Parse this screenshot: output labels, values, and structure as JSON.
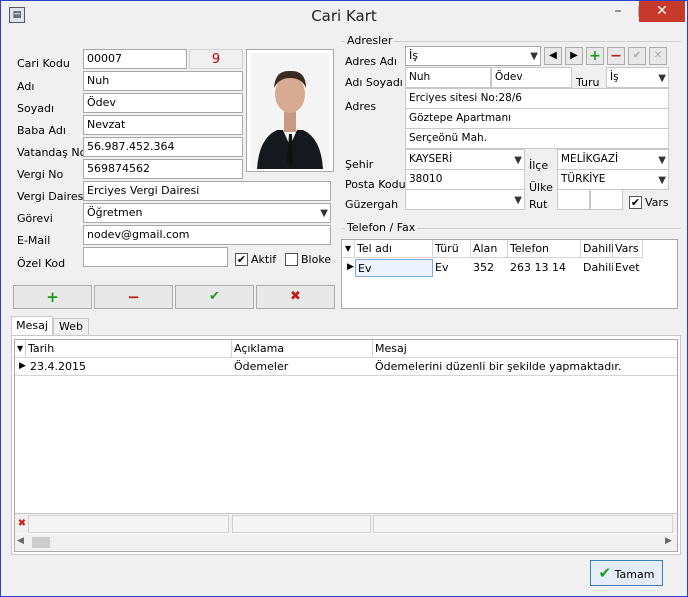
{
  "window": {
    "title": "Cari Kart",
    "minimize": "–",
    "maximize": "□",
    "close": "✕",
    "app_icon": "app-icon"
  },
  "left": {
    "labels": {
      "cari_kodu": "Cari Kodu",
      "adi": "Adı",
      "soyadi": "Soyadı",
      "baba_adi": "Baba Adı",
      "tc": "Vatandaş No",
      "vergi_no": "Vergi No",
      "vergi_dairesi": "Vergi Dairesi",
      "gorevi": "Görevi",
      "email": "E-Mail",
      "ozel_kod": "Özel Kod"
    },
    "values": {
      "cari_kodu": "00007",
      "badge": "9",
      "adi": "Nuh",
      "soyadi": "Ödev",
      "baba_adi": "Nevzat",
      "tc": "56.987.452.364",
      "vergi_no": "569874562",
      "vergi_dairesi": "Erciyes Vergi Dairesi",
      "gorevi": "Öğretmen",
      "email": "nodev@gmail.com",
      "ozel_kod": ""
    },
    "aktif": {
      "label": "Aktif",
      "checked": true
    },
    "bloke": {
      "label": "Bloke",
      "checked": false
    },
    "buttons": {
      "add": "+",
      "remove": "−",
      "ok": "✔",
      "cancel": "✖"
    }
  },
  "adresler": {
    "group": "Adresler",
    "labels": {
      "adres_adi": "Adres Adı",
      "adi_soyadi": "Adı Soyadı",
      "turu": "Turu",
      "adres": "Adres",
      "sehir": "Şehir",
      "ilce": "İlçe",
      "posta": "Posta Kodu",
      "ulke": "Ülke",
      "guzergah": "Güzergah",
      "rut": "Rut",
      "vars": "Vars"
    },
    "values": {
      "adres_adi": "İş",
      "ad": "Nuh",
      "soyad": "Ödev",
      "turu": "İş",
      "adres1": "Erciyes sitesi No:28/6",
      "adres2": "Göztepe Apartmanı",
      "adres3": "Serçeönü Mah.",
      "sehir": "KAYSERİ",
      "ilce": "MELİKGAZİ",
      "posta": "38010",
      "ulke": "TÜRKİYE",
      "guzergah": ""
    },
    "vars_checked": true,
    "nav": {
      "prev": "◀",
      "next": "▶",
      "add": "+",
      "remove": "−",
      "ok": "✔",
      "cancel": "✕"
    }
  },
  "telefon": {
    "group": "Telefon / Fax",
    "columns": [
      "Tel adı",
      "Türü",
      "Alan",
      "Telefon",
      "Dahili",
      "Vars"
    ],
    "rows": [
      [
        "Ev",
        "Ev",
        "352",
        "263 13 14",
        "Dahili",
        "Evet"
      ]
    ]
  },
  "tabs": [
    {
      "label": "Mesaj"
    },
    {
      "label": "Web"
    }
  ],
  "mesaj": {
    "columns": [
      "Tarih",
      "Açıklama",
      "Mesaj"
    ],
    "rows": [
      [
        "23.4.2015",
        "Ödemeler",
        "Ödemelerini düzenli bir şekilde yapmaktadır."
      ]
    ]
  },
  "footer": {
    "ok_label": "Tamam"
  },
  "colors": {
    "accent": "#2a3ec7",
    "badge": "#c00000",
    "plus": "#1e9a1e",
    "minus": "#c41a1a"
  }
}
